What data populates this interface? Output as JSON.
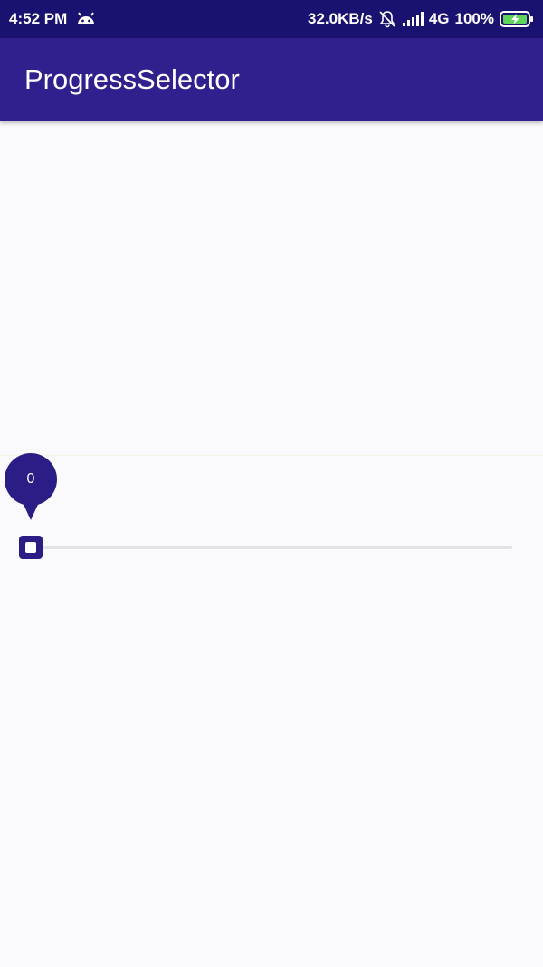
{
  "status_bar": {
    "time": "4:52 PM",
    "network_speed": "32.0KB/s",
    "network_type": "4G",
    "battery": "100%",
    "icons": [
      "android-icon",
      "mute-bell-icon",
      "signal-icon",
      "battery-charging-icon"
    ]
  },
  "app_bar": {
    "title": "ProgressSelector"
  },
  "progress_selector": {
    "value": "0",
    "progress_fraction": 0,
    "accent_color": "#2b1d86",
    "track_color": "#e3e2e8"
  },
  "colors": {
    "status_bar": "#1a1270",
    "app_bar": "#30208e",
    "background": "#faf9fc"
  }
}
